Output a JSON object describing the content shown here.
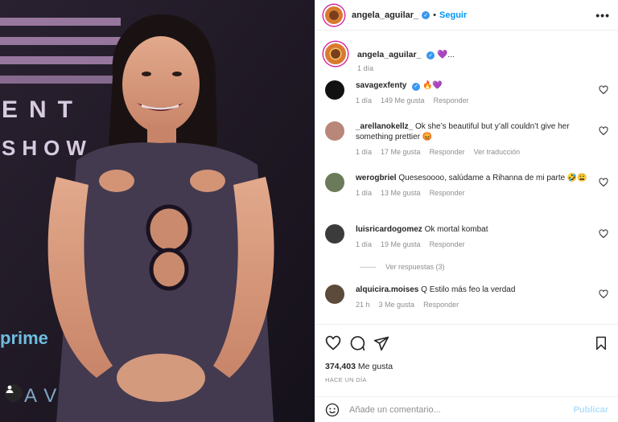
{
  "post": {
    "username": "angela_aguilar_",
    "follow_label": "Seguir",
    "more_label": "•••",
    "caption_emoji": "💜...",
    "caption_time": "1 día",
    "photo_text": {
      "ent": "ENT",
      "show": "SHOW",
      "prime": "prime",
      "av": "AV"
    }
  },
  "comments": [
    {
      "user": "savagexfenty",
      "verified": true,
      "text": "🔥💜",
      "meta": [
        "1 día",
        "149 Me gusta",
        "Responder"
      ],
      "avatar_color": "#111111"
    },
    {
      "user": "_arellanokellz_",
      "verified": false,
      "text": "Ok she’s beautiful but y’all couldn’t give her something prettier 😡",
      "meta": [
        "1 día",
        "17 Me gusta",
        "Responder",
        "Ver traducción"
      ],
      "avatar_color": "#b8877a"
    },
    {
      "user": "werogbriel",
      "verified": false,
      "text": "Quesesoooo, salúdame a Rihanna de mi parte 🤣😩",
      "meta": [
        "1 día",
        "13 Me gusta",
        "Responder"
      ],
      "avatar_color": "#6b7a5a"
    },
    {
      "user": "luisricardogomez",
      "verified": false,
      "text": "Ok mortal kombat",
      "meta": [
        "1 día",
        "19 Me gusta",
        "Responder"
      ],
      "avatar_color": "#3b3b3b"
    },
    {
      "user": "alquicira.moises",
      "verified": false,
      "text": "Q Estilo más feo la verdad",
      "meta": [
        "21 h",
        "3 Me gusta",
        "Responder"
      ],
      "avatar_color": "#5c4a3a"
    }
  ],
  "replies_label": "Ver respuestas (3)",
  "footer": {
    "likes_count": "374,403",
    "likes_label": "Me gusta",
    "posted_ago": "HACE UN DÍA",
    "comment_placeholder": "Añade un comentario...",
    "post_button": "Publicar"
  },
  "colors": {
    "accent": "#0095f6",
    "verified": "#3897f0",
    "muted": "#8e8e8e"
  }
}
